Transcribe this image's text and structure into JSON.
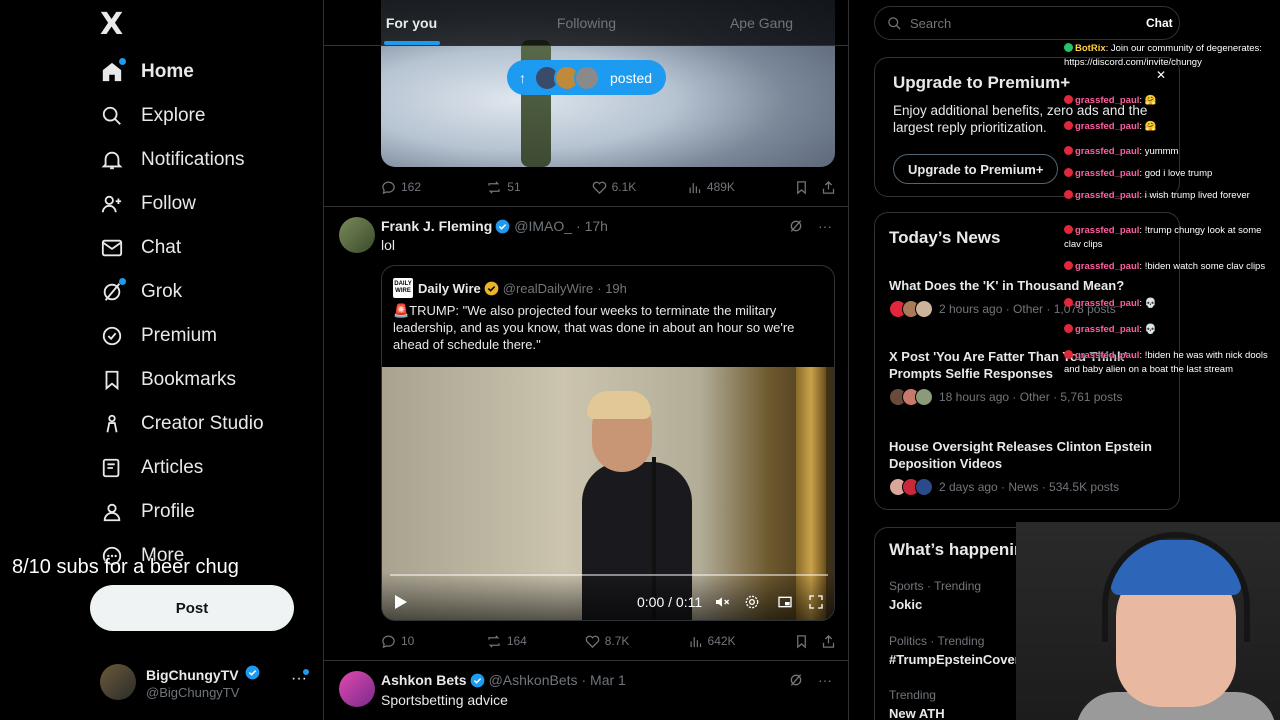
{
  "nav": {
    "logo": "X",
    "items": [
      {
        "label": "Home",
        "icon": "home-icon",
        "bold": true
      },
      {
        "label": "Explore",
        "icon": "search-icon"
      },
      {
        "label": "Notifications",
        "icon": "bell-icon"
      },
      {
        "label": "Follow",
        "icon": "follow-icon"
      },
      {
        "label": "Chat",
        "icon": "mail-icon"
      },
      {
        "label": "Grok",
        "icon": "grok-icon"
      },
      {
        "label": "Premium",
        "icon": "premium-icon"
      },
      {
        "label": "Bookmarks",
        "icon": "bookmark-icon"
      },
      {
        "label": "Creator Studio",
        "icon": "creator-studio-icon"
      },
      {
        "label": "Articles",
        "icon": "articles-icon"
      },
      {
        "label": "Profile",
        "icon": "profile-icon"
      },
      {
        "label": "More",
        "icon": "more-circle-icon"
      }
    ],
    "post_label": "Post",
    "user": {
      "name": "BigChungyTV",
      "handle": "@BigChungyTV"
    }
  },
  "overlay_text": "8/10 subs for a beer chug",
  "feed": {
    "tabs": [
      "For you",
      "Following",
      "Ape Gang"
    ],
    "posted_label": "posted",
    "tweet0": {
      "replies": "162",
      "reposts": "51",
      "likes": "6.1K",
      "views": "489K"
    },
    "tweet1": {
      "name": "Frank J. Fleming",
      "handle": "@IMAO_",
      "time": "· 17h",
      "text": "lol",
      "quote": {
        "logo": "DAILY WIRE",
        "name": "Daily Wire",
        "handle": "@realDailyWire",
        "time": "· 19h",
        "text": "🚨TRUMP: \"We also projected four weeks to terminate the military leadership, and as you know, that was done in about an hour so we're ahead of schedule there.\"",
        "video_time": "0:00 / 0:11"
      },
      "replies": "10",
      "reposts": "164",
      "likes": "8.7K",
      "views": "642K"
    },
    "tweet2": {
      "name": "Ashkon Bets",
      "handle": "@AshkonBets",
      "time": "· Mar 1",
      "text": "Sportsbetting advice"
    }
  },
  "right": {
    "search_placeholder": "Search",
    "chat_label": "Chat",
    "premium": {
      "title": "Upgrade to Premium+",
      "body": "Enjoy additional benefits, zero ads and the largest reply prioritization.",
      "button": "Upgrade to Premium+"
    },
    "news": {
      "title": "Today’s News",
      "items": [
        {
          "title": "What Does the 'K' in Thousand Mean?",
          "meta": "2 hours ago · Other · 1,078 posts"
        },
        {
          "title": "X Post 'You Are Fatter Than You Think' Prompts Selfie Responses",
          "meta": "18 hours ago · Other · 5,761 posts"
        },
        {
          "title": "House Oversight Releases Clinton Epstein Deposition Videos",
          "meta": "2 days ago · News · 534.5K posts"
        }
      ]
    },
    "happening": {
      "title": "What’s happening",
      "trends": [
        {
          "context": "Sports · Trending",
          "name": "Jokic"
        },
        {
          "context": "Politics · Trending",
          "name": "#TrumpEpsteinCoverUp"
        },
        {
          "context": "Trending",
          "name": "New ATH"
        }
      ]
    }
  },
  "chat": {
    "messages": [
      {
        "user": "BotRix",
        "text": ": Join our community of degenerates: https://discord.com/invite/chungy",
        "color": "#ff5fa2"
      },
      {
        "user": "grassfed_paul",
        "text": ": 🤗",
        "color": "#ff5fa2"
      },
      {
        "user": "grassfed_paul",
        "text": ": 🤗",
        "color": "#ff5fa2"
      },
      {
        "user": "grassfed_paul",
        "text": ": yummm",
        "color": "#ff5fa2"
      },
      {
        "user": "grassfed_paul",
        "text": ": god i love trump",
        "color": "#ff5fa2"
      },
      {
        "user": "grassfed_paul",
        "text": ": i wish trump lived forever",
        "color": "#ff5fa2"
      },
      {
        "user": "grassfed_paul",
        "text": ": !trump chungy look at some clav clips",
        "color": "#ff5fa2"
      },
      {
        "user": "grassfed_paul",
        "text": ": !biden watch some clav clips",
        "color": "#ff5fa2"
      },
      {
        "user": "grassfed_paul",
        "text": ": 💀",
        "color": "#ff5fa2"
      },
      {
        "user": "grassfed_paul",
        "text": ": 💀",
        "color": "#ff5fa2"
      },
      {
        "user": "grassfed_paul",
        "text": ": !biden he was with nick dools and baby alien on a boat the last stream",
        "color": "#ff5fa2"
      }
    ]
  },
  "colors": {
    "accent": "#1d9bf0",
    "bg": "#000000",
    "border": "#2f3336",
    "muted": "#71767b"
  }
}
